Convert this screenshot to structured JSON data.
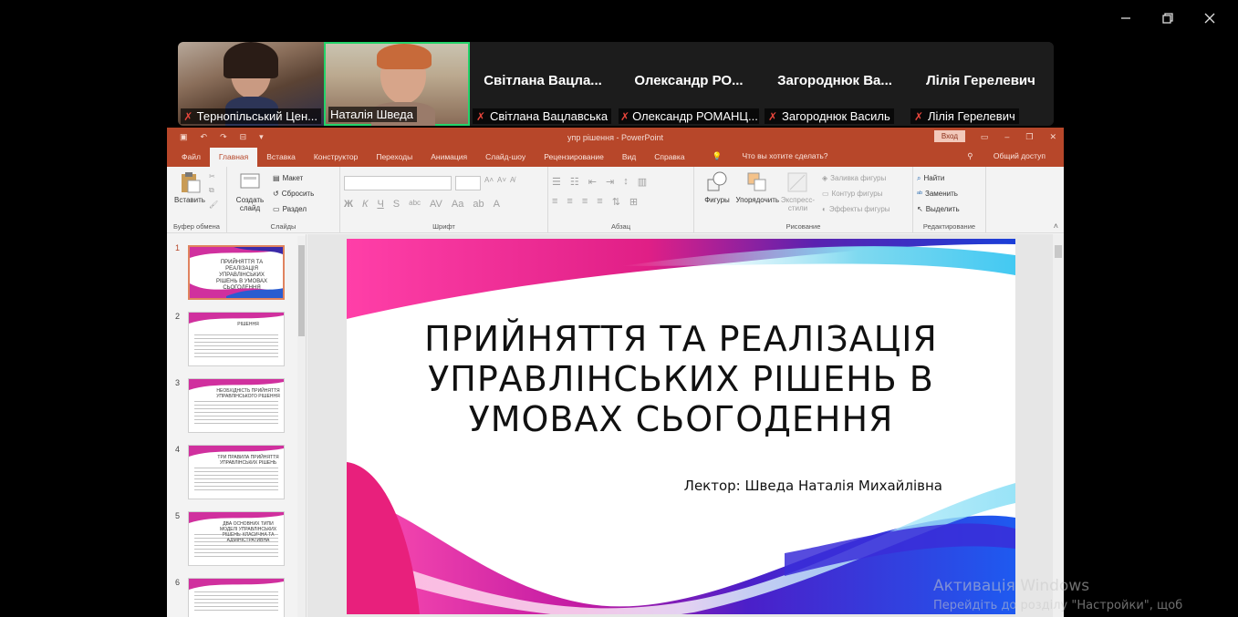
{
  "window": {
    "controls": [
      "minimize-icon",
      "restore-icon",
      "close-icon"
    ]
  },
  "participants": [
    {
      "tag": "Тернопільський Цен...",
      "has_video": true,
      "muted": true
    },
    {
      "tag": "Наталія Шведа",
      "has_video": true,
      "muted": false,
      "active_speaker": true
    },
    {
      "big_name": "Світлана  Вацла...",
      "tag": "Світлана Вацлавська",
      "has_video": false,
      "muted": true
    },
    {
      "big_name": "Олександр  РО...",
      "tag": "Олександр РОМАНЦ...",
      "has_video": false,
      "muted": true
    },
    {
      "big_name": "Загороднюк  Ва...",
      "tag": "Загороднюк Василь",
      "has_video": false,
      "muted": true
    },
    {
      "big_name": "Лілія Герелевич",
      "tag": "Лілія Герелевич",
      "has_video": false,
      "muted": true
    }
  ],
  "ppt": {
    "doc_title": "упр рішення  -  PowerPoint",
    "login": "Вход",
    "tabs": [
      "Файл",
      "Главная",
      "Вставка",
      "Конструктор",
      "Переходы",
      "Анимация",
      "Слайд-шоу",
      "Рецензирование",
      "Вид",
      "Справка"
    ],
    "active_tab": "Главная",
    "tell_me": "Что вы хотите сделать?",
    "share": "Общий доступ",
    "ribbon": {
      "clipboard": {
        "paste": "Вставить",
        "label": "Буфер обмена"
      },
      "slides": {
        "new_slide": "Создать слайд",
        "layout": "Макет",
        "reset": "Сбросить",
        "section": "Раздел",
        "label": "Слайды"
      },
      "font": {
        "bold": "Ж",
        "italic": "К",
        "underline": "Ч",
        "strike": "S",
        "abc": "abc",
        "label": "Шрифт"
      },
      "paragraph": {
        "label": "Абзац"
      },
      "drawing": {
        "shapes": "Фигуры",
        "arrange": "Упорядочить",
        "quick_styles": "Экспресс-стили",
        "fill": "Заливка фигуры",
        "outline": "Контур фигуры",
        "effects": "Эффекты фигуры",
        "label": "Рисование"
      },
      "editing": {
        "find": "Найти",
        "replace": "Заменить",
        "select": "Выделить",
        "label": "Редактирование"
      }
    },
    "thumbnails": [
      {
        "num": "1",
        "title": "ПРИЙНЯТТЯ ТА РЕАЛІЗАЦІЯ УПРАВЛІНСЬКИХ РІШЕНЬ В УМОВАХ СЬОГОДЕННЯ",
        "selected": true
      },
      {
        "num": "2",
        "title": "РІШЕННЯ"
      },
      {
        "num": "3",
        "title": "НЕОБХІДНІСТЬ ПРИЙНЯТТЯ УПРАВЛІНСЬКОГО РІШЕННЯ"
      },
      {
        "num": "4",
        "title": "ТРИ ПРАВИЛА ПРИЙНЯТТЯ УПРАВЛІНСЬКИХ РІШЕНЬ"
      },
      {
        "num": "5",
        "title": "ДВА ОСНОВНИХ ТИПИ МОДЕЛІ УПРАВЛІНСЬКИХ РІШЕНЬ: КЛАСИЧНА ТА АДМІНІСТРАТИВНА"
      },
      {
        "num": "6",
        "title": ""
      }
    ],
    "slide": {
      "title_lines": [
        "ПРИЙНЯТТЯ ТА РЕАЛІЗАЦІЯ",
        "УПРАВЛІНСЬКИХ РІШЕНЬ В",
        "УМОВАХ СЬОГОДЕННЯ"
      ],
      "lector": "Лектор: Шведа Наталія Михайлівна"
    }
  },
  "watermark": {
    "line1": "Активація Windows",
    "line2": "Перейдіть до розділу \"Настройки\", щоб"
  },
  "colors": {
    "ppt_accent": "#b7472a",
    "active_speaker_border": "#24d36a",
    "muted_mic": "#e8463c"
  }
}
